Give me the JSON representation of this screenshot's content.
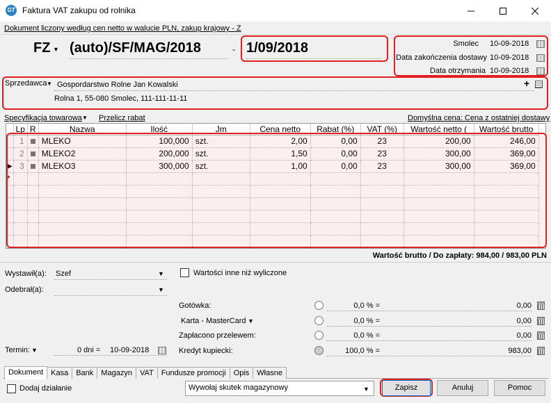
{
  "window": {
    "title": "Faktura VAT zakupu od rolnika",
    "icon_label": "GT"
  },
  "header": {
    "document_info": "Dokument liczony według cen netto w walucie PLN, zakup krajowy - Z",
    "doc_type": "FZ",
    "doc_number": "(auto)/SF/MAG/2018",
    "separator": "-",
    "doc_date": "1/09/2018",
    "dates": [
      {
        "label": "Smolec",
        "value": "10-09-2018"
      },
      {
        "label": "Data zakończenia dostawy",
        "value": "10-09-2018"
      },
      {
        "label": "Data otrzymania",
        "value": "10-09-2018"
      }
    ]
  },
  "seller": {
    "label": "Sprzedawca",
    "name": "Gospordarstwo Rolne Jan Kowalski",
    "address": "Rolna 1, 55-080 Smolec, 111-111-11-11",
    "add_icon": "plus-icon",
    "card_icon": "card-icon"
  },
  "items_bar": {
    "spec_label": "Specyfikacja towarowa",
    "recalc_label": "Przelicz rabat",
    "default_price_label": "Domyślna cena: Cena z ostatniej dostawy"
  },
  "table": {
    "columns": [
      "Lp",
      "R",
      "Nazwa",
      "Ilość",
      "Jm",
      "Cena netto",
      "Rabat (%)",
      "VAT (%)",
      "Wartość netto (",
      "Wartość brutto"
    ],
    "rows": [
      {
        "lp": "1",
        "name": "MLEKO",
        "qty": "100,000",
        "unit": "szt.",
        "price": "2,00",
        "discount": "0,00",
        "vat": "23",
        "net": "200,00",
        "gross": "246,00"
      },
      {
        "lp": "2",
        "name": "MLEKO2",
        "qty": "200,000",
        "unit": "szt.",
        "price": "1,50",
        "discount": "0,00",
        "vat": "23",
        "net": "300,00",
        "gross": "369,00"
      },
      {
        "lp": "3",
        "name": "MLEKO3",
        "qty": "300,000",
        "unit": "szt.",
        "price": "1,00",
        "discount": "0,00",
        "vat": "23",
        "net": "300,00",
        "gross": "369,00"
      }
    ],
    "new_row_marker": "*"
  },
  "total": {
    "text": "Wartość brutto / Do zapłaty: 984,00 / 983,00 PLN"
  },
  "people": {
    "issued_label": "Wystawił(a):",
    "issued_value": "Szef",
    "received_label": "Odebrał(a):",
    "received_value": ""
  },
  "other_values": {
    "label": "Wartości inne niż wyliczone",
    "checked": false
  },
  "payments": [
    {
      "label": "Gotówka:",
      "percent": "0,0 % =",
      "amount": "0,00",
      "has_dropdown": false,
      "selected": false
    },
    {
      "label": "Karta - MasterCard",
      "percent": "0,0 % =",
      "amount": "0,00",
      "has_dropdown": true,
      "selected": false
    },
    {
      "label": "Zapłacono przelewem:",
      "percent": "0,0 % =",
      "amount": "0,00",
      "has_dropdown": false,
      "selected": false
    },
    {
      "label": "Kredyt kupiecki:",
      "percent": "100,0 % =",
      "amount": "983,00",
      "has_dropdown": false,
      "selected": true
    }
  ],
  "term": {
    "label": "Termin:",
    "days": "0 dni =",
    "date": "10-09-2018"
  },
  "tabs": [
    "Dokument",
    "Kasa",
    "Bank",
    "Magazyn",
    "VAT",
    "Fundusze promocji",
    "Opis",
    "Własne"
  ],
  "active_tab": "Dokument",
  "footer": {
    "add_action_label": "Dodaj działanie",
    "stock_effect": "Wywołaj skutek magazynowy",
    "save_label": "Zapisz",
    "cancel_label": "Anuluj",
    "help_label": "Pomoc"
  },
  "colors": {
    "highlight_border": "#e02020",
    "focus_border": "#0078d7"
  }
}
